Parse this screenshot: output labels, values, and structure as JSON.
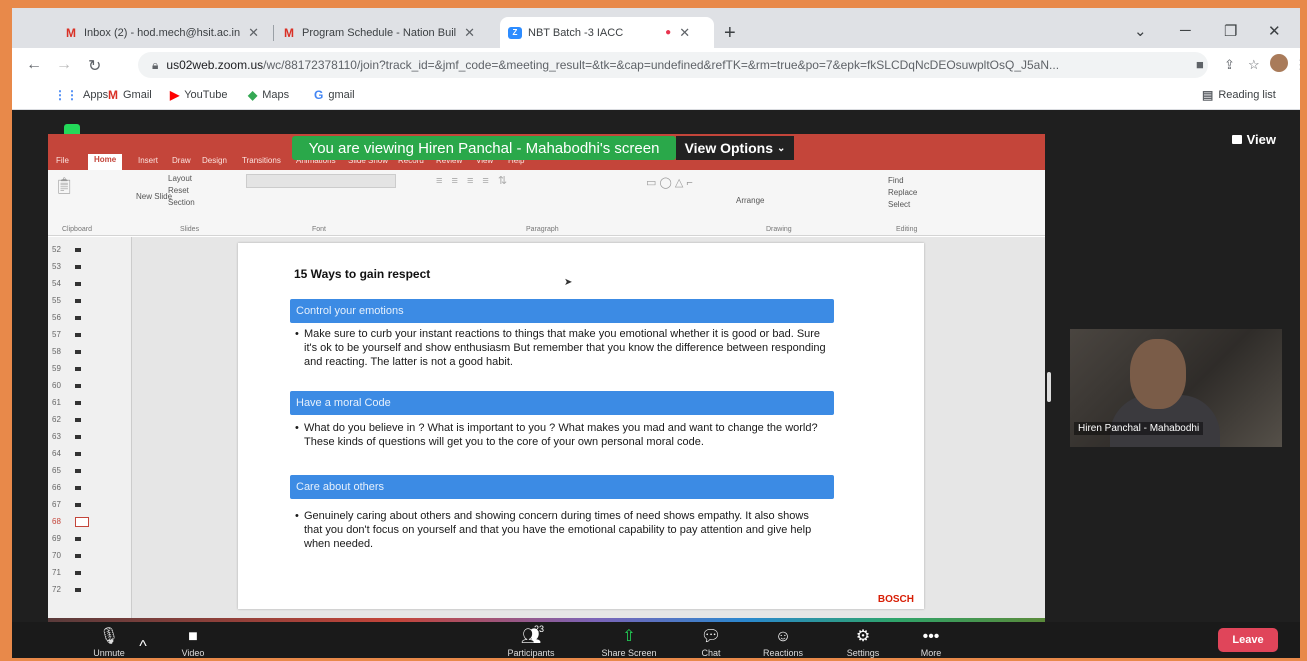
{
  "browser": {
    "tabs": [
      {
        "label": "Inbox (2) - hod.mech@hsit.ac.in",
        "favicon": "M"
      },
      {
        "label": "Program Schedule - Nation Buil",
        "favicon": "M"
      },
      {
        "label": "NBT Batch -3 IACC",
        "favicon": "Z"
      }
    ],
    "new_tab": "+",
    "url_host": "us02web.zoom.us",
    "url_path": "/wc/88172378110/join?track_id=&jmf_code=&meeting_result=&tk=&cap=undefined&refTK=&rm=true&po=7&epk=fkSLCDqNcDEOsuwpltOsQ_J5aN...",
    "bookmarks": [
      "Apps",
      "Gmail",
      "YouTube",
      "Maps",
      "gmail"
    ],
    "reading_list": "Reading list"
  },
  "zoom": {
    "viewing_banner": "You are viewing Hiren Panchal - Mahabodhi's screen",
    "view_options": "View Options",
    "view_button": "View",
    "participant_name": "Hiren Panchal - Mahabodhi",
    "participants_count": "23",
    "controls": [
      "Unmute",
      "Video",
      "Participants",
      "Share Screen",
      "Chat",
      "Reactions",
      "Settings",
      "More"
    ],
    "leave": "Leave"
  },
  "ppt": {
    "tabs": [
      "File",
      "Home",
      "Insert",
      "Draw",
      "Design",
      "Transitions",
      "Animations",
      "Slide Show",
      "Record",
      "Review",
      "View",
      "Help"
    ],
    "ribbon_groups": [
      "Clipboard",
      "Slides",
      "Font",
      "Paragraph",
      "Drawing",
      "Editing"
    ],
    "ribbon_items": {
      "layout": "Layout",
      "reset": "Reset",
      "new_slide": "New Slide",
      "section": "Section",
      "arrange": "Arrange",
      "find": "Find",
      "replace": "Replace",
      "select": "Select"
    },
    "slide_numbers": [
      "52",
      "53",
      "54",
      "55",
      "56",
      "57",
      "58",
      "59",
      "60",
      "61",
      "62",
      "63",
      "64",
      "65",
      "66",
      "67",
      "68",
      "69",
      "70",
      "71",
      "72"
    ],
    "selected_slide": "68",
    "slide": {
      "title": "15 Ways to gain respect",
      "sections": [
        {
          "heading": "Control your emotions",
          "body": "Make sure to curb your instant reactions to things that make you emotional whether it is good or bad. Sure it's ok to be yourself and show enthusiasm But remember that you know the difference between responding and reacting. The latter is not a good habit."
        },
        {
          "heading": "Have a moral Code",
          "body": "What do you believe in ? What is important to you ? What makes you mad and want to change the world? These kinds of questions will get you to the core of your own personal moral code."
        },
        {
          "heading": "Care about others",
          "body": "Genuinely caring about others and showing concern during times of need shows empathy. It also shows that you don't focus on yourself and that you have the emotional capability to pay attention and give help when needed."
        }
      ],
      "brand": "BOSCH"
    }
  }
}
